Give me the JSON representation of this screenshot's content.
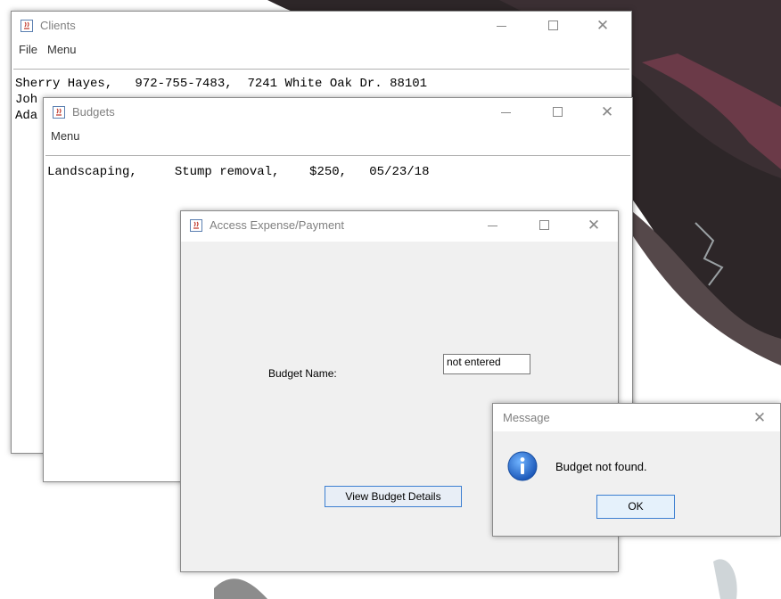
{
  "clients_window": {
    "title": "Clients",
    "menu": [
      "File",
      "Menu"
    ],
    "lines": [
      "Sherry Hayes,   972-755-7483,  7241 White Oak Dr. 88101",
      "Joh",
      "Ada"
    ]
  },
  "budgets_window": {
    "title": "Budgets",
    "menu": [
      "Menu"
    ],
    "lines": [
      "Landscaping,     Stump removal,    $250,   05/23/18"
    ]
  },
  "access_window": {
    "title": "Access Expense/Payment",
    "budget_name_label": "Budget Name:",
    "budget_name_value": "not entered",
    "view_button_label": "View Budget Details"
  },
  "message_dialog": {
    "title": "Message",
    "text": "Budget not found.",
    "ok_label": "OK",
    "icon": "info-icon"
  },
  "window_controls": {
    "minimize": "minimize-icon",
    "maximize": "maximize-icon",
    "close": "✕"
  }
}
